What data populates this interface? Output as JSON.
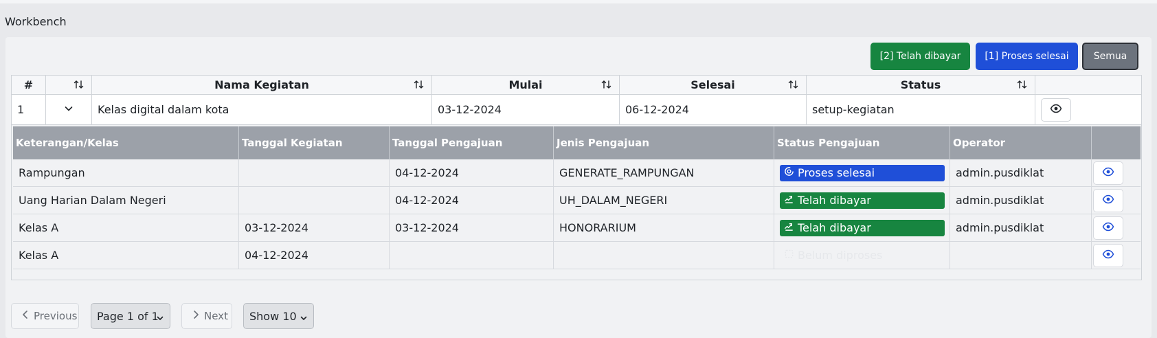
{
  "page": {
    "title": "Workbench"
  },
  "filters": {
    "paid_label": "[2] Telah dibayar",
    "done_label": "[1] Proses selesai",
    "all_label": "Semua"
  },
  "main_table": {
    "headers": {
      "num": "#",
      "name": "Nama Kegiatan",
      "start": "Mulai",
      "end": "Selesai",
      "status": "Status"
    },
    "row": {
      "num": "1",
      "name": "Kelas digital dalam kota",
      "start": "03-12-2024",
      "end": "06-12-2024",
      "status": "setup-kegiatan"
    }
  },
  "sub_table": {
    "headers": {
      "keterangan": "Keterangan/Kelas",
      "tanggal_kegiatan": "Tanggal Kegiatan",
      "tanggal_pengajuan": "Tanggal Pengajuan",
      "jenis": "Jenis Pengajuan",
      "status": "Status Pengajuan",
      "operator": "Operator"
    },
    "rows": [
      {
        "keterangan": "Rampungan",
        "tanggal_kegiatan": "",
        "tanggal_pengajuan": "04-12-2024",
        "jenis": "GENERATE_RAMPUNGAN",
        "status": "Proses selesai",
        "operator": "admin.pusdiklat"
      },
      {
        "keterangan": "Uang Harian Dalam Negeri",
        "tanggal_kegiatan": "",
        "tanggal_pengajuan": "04-12-2024",
        "jenis": "UH_DALAM_NEGERI",
        "status": "Telah dibayar",
        "operator": "admin.pusdiklat"
      },
      {
        "keterangan": "Kelas A",
        "tanggal_kegiatan": "03-12-2024",
        "tanggal_pengajuan": "03-12-2024",
        "jenis": "HONORARIUM",
        "status": "Telah dibayar",
        "operator": "admin.pusdiklat"
      },
      {
        "keterangan": "Kelas A",
        "tanggal_kegiatan": "04-12-2024",
        "tanggal_pengajuan": "",
        "jenis": "",
        "status": "Belum diproses",
        "operator": ""
      }
    ]
  },
  "pagination": {
    "previous": "Previous",
    "page": "Page 1 of 1",
    "next": "Next",
    "show": "Show 10"
  },
  "colors": {
    "blue": "#1f4fd8",
    "green": "#178540",
    "gray": "#6c737d"
  }
}
